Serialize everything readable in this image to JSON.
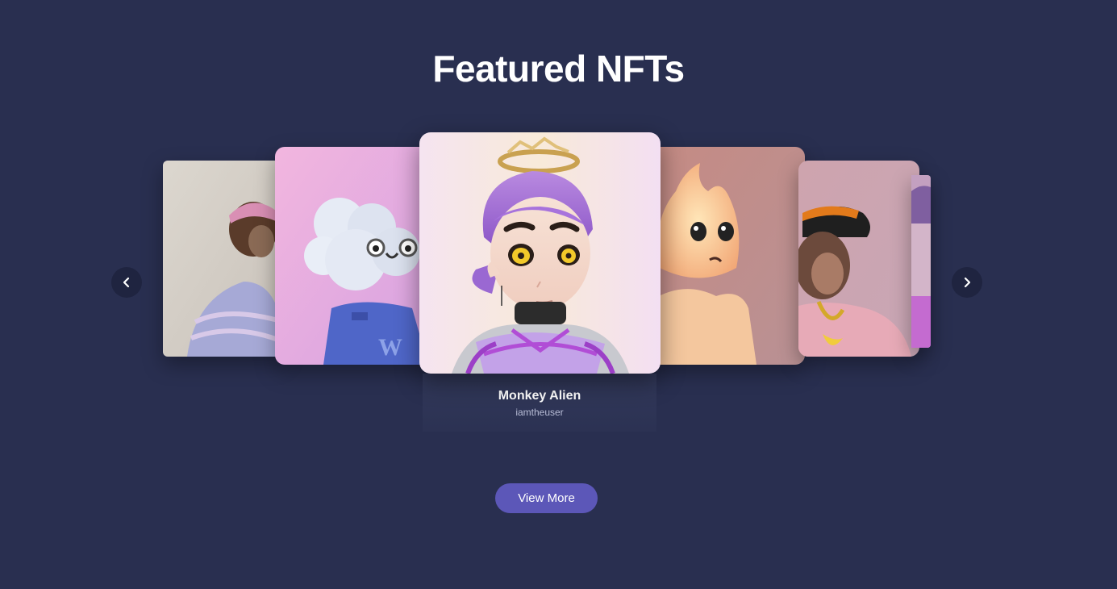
{
  "section": {
    "title": "Featured NFTs"
  },
  "carousel": {
    "featured": {
      "name": "Monkey Alien",
      "owner": "iamtheuser"
    },
    "cards": [
      {
        "icon": "ape-artwork"
      },
      {
        "icon": "cloud-character-artwork"
      },
      {
        "icon": "anime-girl-artwork"
      },
      {
        "icon": "flame-character-artwork"
      },
      {
        "icon": "ape-with-cap-artwork"
      }
    ],
    "prev_icon": "chevron-left-icon",
    "next_icon": "chevron-right-icon"
  },
  "actions": {
    "view_more_label": "View More"
  },
  "colors": {
    "background": "#292f50",
    "button": "#5c57b8"
  }
}
